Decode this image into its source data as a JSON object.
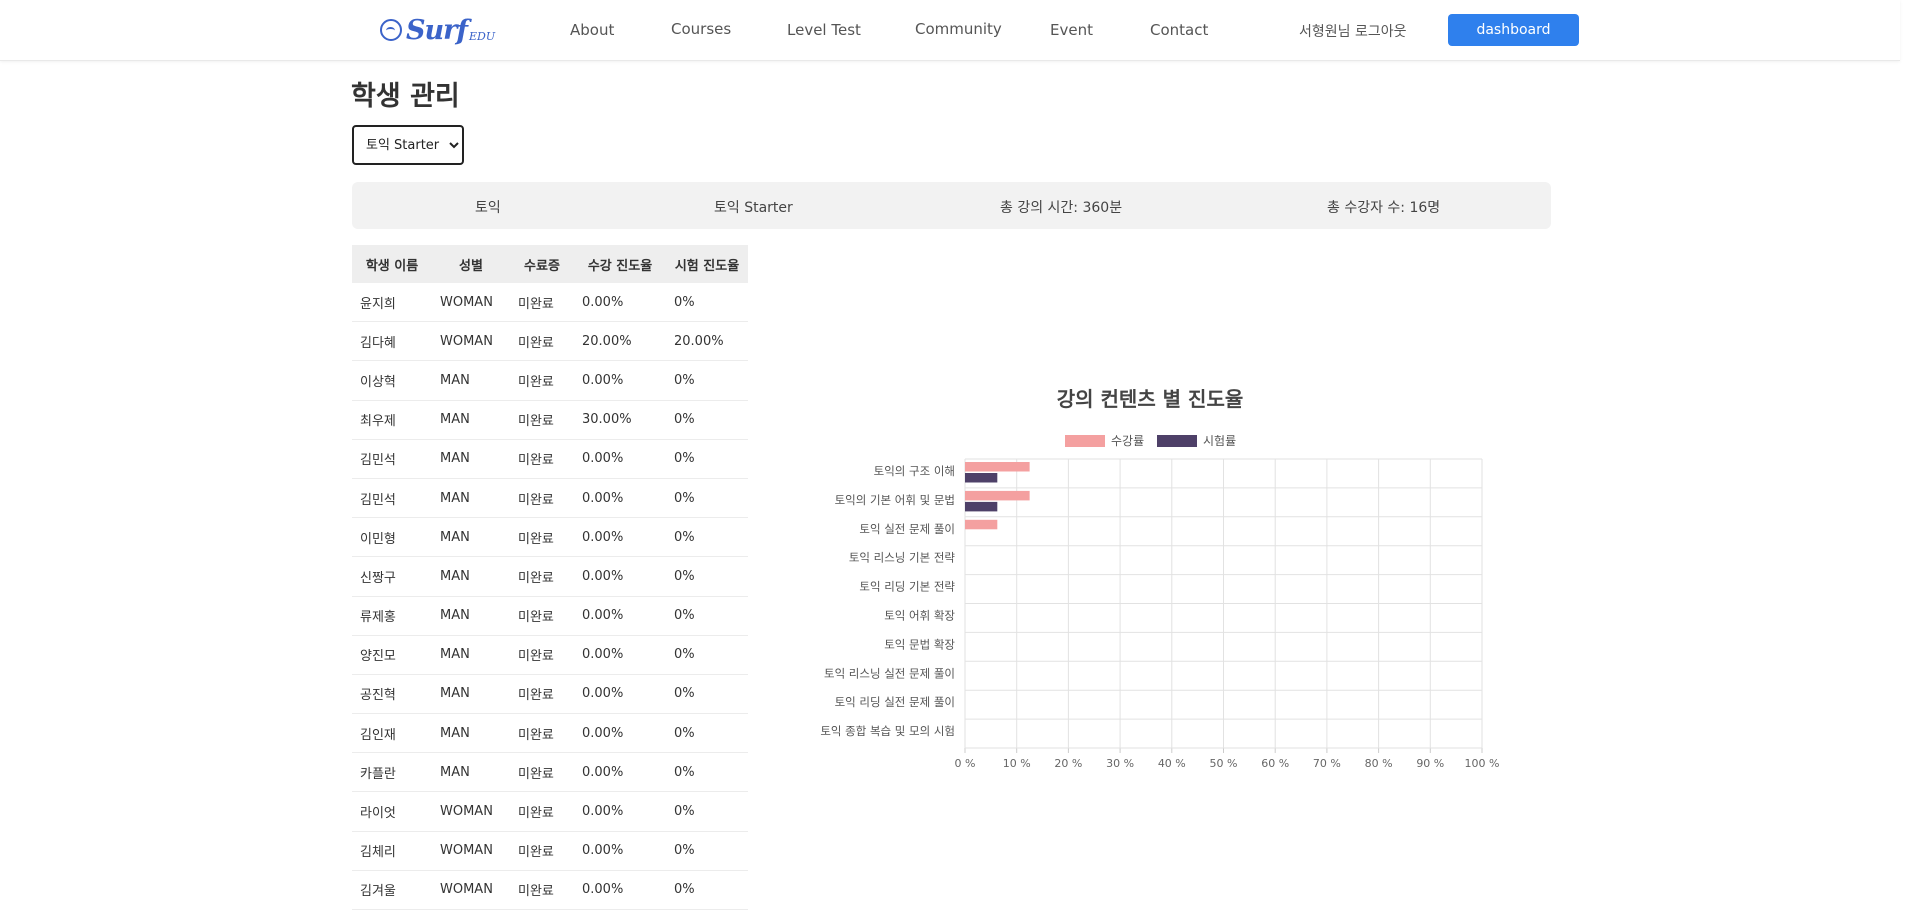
{
  "header": {
    "logo_text": "Surf",
    "logo_sub": "EDU",
    "nav": [
      "About",
      "Courses",
      "Level Test",
      "Community",
      "Event",
      "Contact"
    ],
    "logout_label": "서형원님 로그아웃",
    "dashboard_label": "dashboard"
  },
  "page": {
    "title": "학생 관리",
    "selected_course": "토익 Starter"
  },
  "info": {
    "category": "토익",
    "course": "토익 Starter",
    "total_time": "총 강의 시간: 360분",
    "total_students": "총 수강자 수: 16명"
  },
  "table": {
    "headers": [
      "학생 이름",
      "성별",
      "수료증",
      "수강 진도율",
      "시험 진도율"
    ],
    "rows": [
      [
        "윤지희",
        "WOMAN",
        "미완료",
        "0.00%",
        "0%"
      ],
      [
        "김다혜",
        "WOMAN",
        "미완료",
        "20.00%",
        "20.00%"
      ],
      [
        "이상혁",
        "MAN",
        "미완료",
        "0.00%",
        "0%"
      ],
      [
        "최우제",
        "MAN",
        "미완료",
        "30.00%",
        "0%"
      ],
      [
        "김민석",
        "MAN",
        "미완료",
        "0.00%",
        "0%"
      ],
      [
        "김민석",
        "MAN",
        "미완료",
        "0.00%",
        "0%"
      ],
      [
        "이민형",
        "MAN",
        "미완료",
        "0.00%",
        "0%"
      ],
      [
        "신짱구",
        "MAN",
        "미완료",
        "0.00%",
        "0%"
      ],
      [
        "류제홍",
        "MAN",
        "미완료",
        "0.00%",
        "0%"
      ],
      [
        "양진모",
        "MAN",
        "미완료",
        "0.00%",
        "0%"
      ],
      [
        "공진혁",
        "MAN",
        "미완료",
        "0.00%",
        "0%"
      ],
      [
        "김인재",
        "MAN",
        "미완료",
        "0.00%",
        "0%"
      ],
      [
        "카플란",
        "MAN",
        "미완료",
        "0.00%",
        "0%"
      ],
      [
        "라이엇",
        "WOMAN",
        "미완료",
        "0.00%",
        "0%"
      ],
      [
        "김체리",
        "WOMAN",
        "미완료",
        "0.00%",
        "0%"
      ],
      [
        "김겨울",
        "WOMAN",
        "미완료",
        "0.00%",
        "0%"
      ]
    ]
  },
  "colors": {
    "primary": "#2f80ed",
    "series_lecture": "#f4a0a0",
    "series_exam": "#4e4068"
  },
  "chart_data": {
    "type": "bar",
    "orientation": "horizontal",
    "title": "강의 컨텐츠 별 진도율",
    "categories": [
      "토익의 구조 이해",
      "토익의 기본 어휘 및 문법",
      "토익 실전 문제 풀이",
      "토익 리스닝 기본 전략",
      "토익 리딩 기본 전략",
      "토익 어휘 확장",
      "토익 문법 확장",
      "토익 리스닝 실전 문제 풀이",
      "토익 리딩 실전 문제 풀이",
      "토익 종합 복습 및 모의 시험"
    ],
    "series": [
      {
        "name": "수강률",
        "values": [
          12.5,
          12.5,
          6.25,
          0,
          0,
          0,
          0,
          0,
          0,
          0
        ]
      },
      {
        "name": "시험률",
        "values": [
          6.25,
          6.25,
          0,
          0,
          0,
          0,
          0,
          0,
          0,
          0
        ]
      }
    ],
    "xlim": [
      0,
      100
    ],
    "x_ticks": [
      "0 %",
      "10 %",
      "20 %",
      "30 %",
      "40 %",
      "50 %",
      "60 %",
      "70 %",
      "80 %",
      "90 %",
      "100 %"
    ],
    "grid": true,
    "legend_position": "top"
  }
}
